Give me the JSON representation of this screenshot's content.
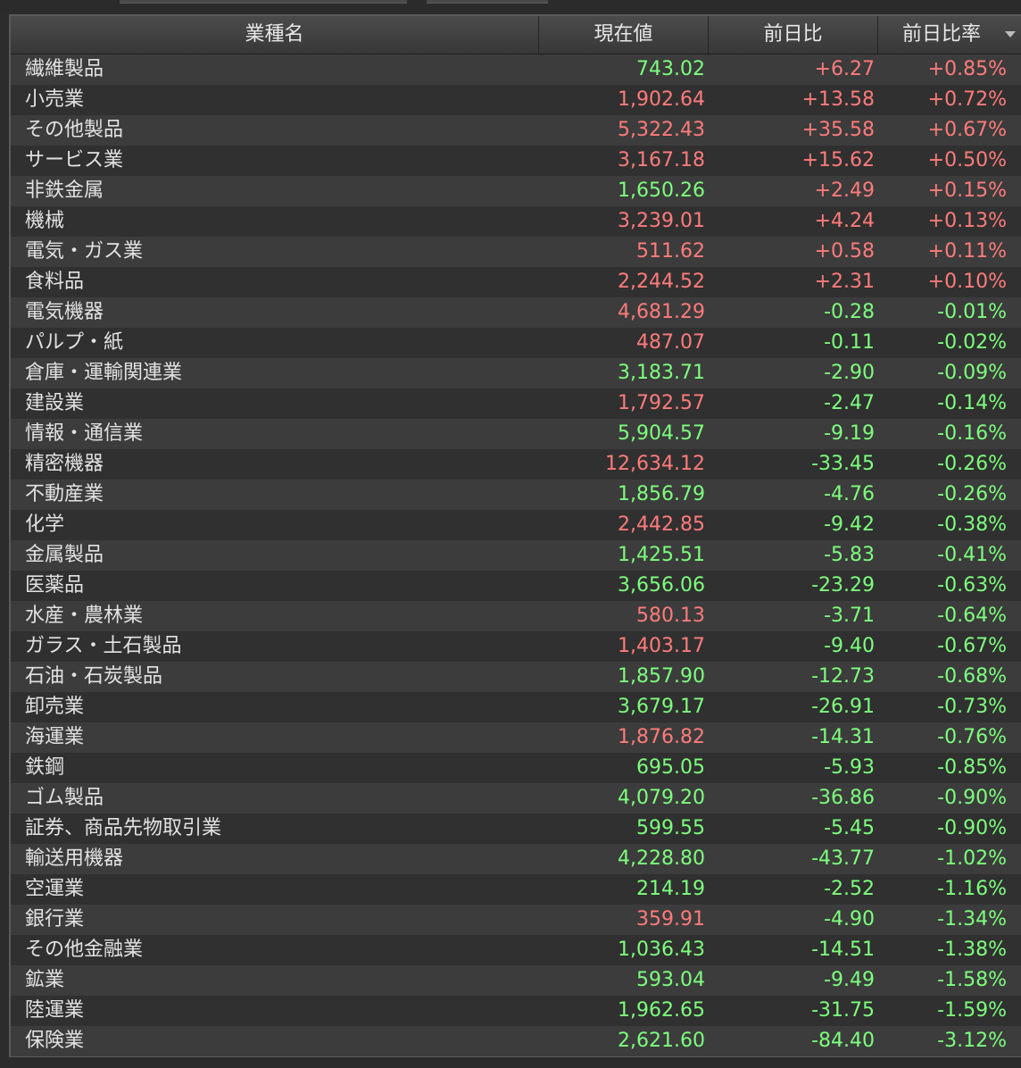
{
  "colors": {
    "up": "#ff7b7b",
    "down": "#7dff7d",
    "header_text": "#e8e8e8",
    "name_text": "#e2e2e2",
    "row_odd": "#3c3c3c",
    "row_even": "#303030"
  },
  "table": {
    "columns": [
      {
        "label": "業種名"
      },
      {
        "label": "現在値"
      },
      {
        "label": "前日比"
      },
      {
        "label": "前日比率",
        "sort": "descending",
        "sort_icon": "sort-descending-icon"
      }
    ],
    "rows": [
      {
        "name": "繊維製品",
        "price": "743.02",
        "price_dir": "down",
        "change": "+6.27",
        "pct": "+0.85%"
      },
      {
        "name": "小売業",
        "price": "1,902.64",
        "price_dir": "up",
        "change": "+13.58",
        "pct": "+0.72%"
      },
      {
        "name": "その他製品",
        "price": "5,322.43",
        "price_dir": "up",
        "change": "+35.58",
        "pct": "+0.67%"
      },
      {
        "name": "サービス業",
        "price": "3,167.18",
        "price_dir": "up",
        "change": "+15.62",
        "pct": "+0.50%"
      },
      {
        "name": "非鉄金属",
        "price": "1,650.26",
        "price_dir": "down",
        "change": "+2.49",
        "pct": "+0.15%"
      },
      {
        "name": "機械",
        "price": "3,239.01",
        "price_dir": "up",
        "change": "+4.24",
        "pct": "+0.13%"
      },
      {
        "name": "電気・ガス業",
        "price": "511.62",
        "price_dir": "up",
        "change": "+0.58",
        "pct": "+0.11%"
      },
      {
        "name": "食料品",
        "price": "2,244.52",
        "price_dir": "up",
        "change": "+2.31",
        "pct": "+0.10%"
      },
      {
        "name": "電気機器",
        "price": "4,681.29",
        "price_dir": "up",
        "change": "-0.28",
        "pct": "-0.01%"
      },
      {
        "name": "パルプ・紙",
        "price": "487.07",
        "price_dir": "up",
        "change": "-0.11",
        "pct": "-0.02%"
      },
      {
        "name": "倉庫・運輸関連業",
        "price": "3,183.71",
        "price_dir": "down",
        "change": "-2.90",
        "pct": "-0.09%"
      },
      {
        "name": "建設業",
        "price": "1,792.57",
        "price_dir": "up",
        "change": "-2.47",
        "pct": "-0.14%"
      },
      {
        "name": "情報・通信業",
        "price": "5,904.57",
        "price_dir": "down",
        "change": "-9.19",
        "pct": "-0.16%"
      },
      {
        "name": "精密機器",
        "price": "12,634.12",
        "price_dir": "up",
        "change": "-33.45",
        "pct": "-0.26%"
      },
      {
        "name": "不動産業",
        "price": "1,856.79",
        "price_dir": "down",
        "change": "-4.76",
        "pct": "-0.26%"
      },
      {
        "name": "化学",
        "price": "2,442.85",
        "price_dir": "up",
        "change": "-9.42",
        "pct": "-0.38%"
      },
      {
        "name": "金属製品",
        "price": "1,425.51",
        "price_dir": "down",
        "change": "-5.83",
        "pct": "-0.41%"
      },
      {
        "name": "医薬品",
        "price": "3,656.06",
        "price_dir": "down",
        "change": "-23.29",
        "pct": "-0.63%"
      },
      {
        "name": "水産・農林業",
        "price": "580.13",
        "price_dir": "up",
        "change": "-3.71",
        "pct": "-0.64%"
      },
      {
        "name": "ガラス・土石製品",
        "price": "1,403.17",
        "price_dir": "up",
        "change": "-9.40",
        "pct": "-0.67%"
      },
      {
        "name": "石油・石炭製品",
        "price": "1,857.90",
        "price_dir": "down",
        "change": "-12.73",
        "pct": "-0.68%"
      },
      {
        "name": "卸売業",
        "price": "3,679.17",
        "price_dir": "down",
        "change": "-26.91",
        "pct": "-0.73%"
      },
      {
        "name": "海運業",
        "price": "1,876.82",
        "price_dir": "up",
        "change": "-14.31",
        "pct": "-0.76%"
      },
      {
        "name": "鉄鋼",
        "price": "695.05",
        "price_dir": "down",
        "change": "-5.93",
        "pct": "-0.85%"
      },
      {
        "name": "ゴム製品",
        "price": "4,079.20",
        "price_dir": "down",
        "change": "-36.86",
        "pct": "-0.90%"
      },
      {
        "name": "証券、商品先物取引業",
        "price": "599.55",
        "price_dir": "down",
        "change": "-5.45",
        "pct": "-0.90%"
      },
      {
        "name": "輸送用機器",
        "price": "4,228.80",
        "price_dir": "down",
        "change": "-43.77",
        "pct": "-1.02%"
      },
      {
        "name": "空運業",
        "price": "214.19",
        "price_dir": "down",
        "change": "-2.52",
        "pct": "-1.16%"
      },
      {
        "name": "銀行業",
        "price": "359.91",
        "price_dir": "up",
        "change": "-4.90",
        "pct": "-1.34%"
      },
      {
        "name": "その他金融業",
        "price": "1,036.43",
        "price_dir": "down",
        "change": "-14.51",
        "pct": "-1.38%"
      },
      {
        "name": "鉱業",
        "price": "593.04",
        "price_dir": "down",
        "change": "-9.49",
        "pct": "-1.58%"
      },
      {
        "name": "陸運業",
        "price": "1,962.65",
        "price_dir": "down",
        "change": "-31.75",
        "pct": "-1.59%"
      },
      {
        "name": "保険業",
        "price": "2,621.60",
        "price_dir": "down",
        "change": "-84.40",
        "pct": "-3.12%"
      }
    ]
  }
}
